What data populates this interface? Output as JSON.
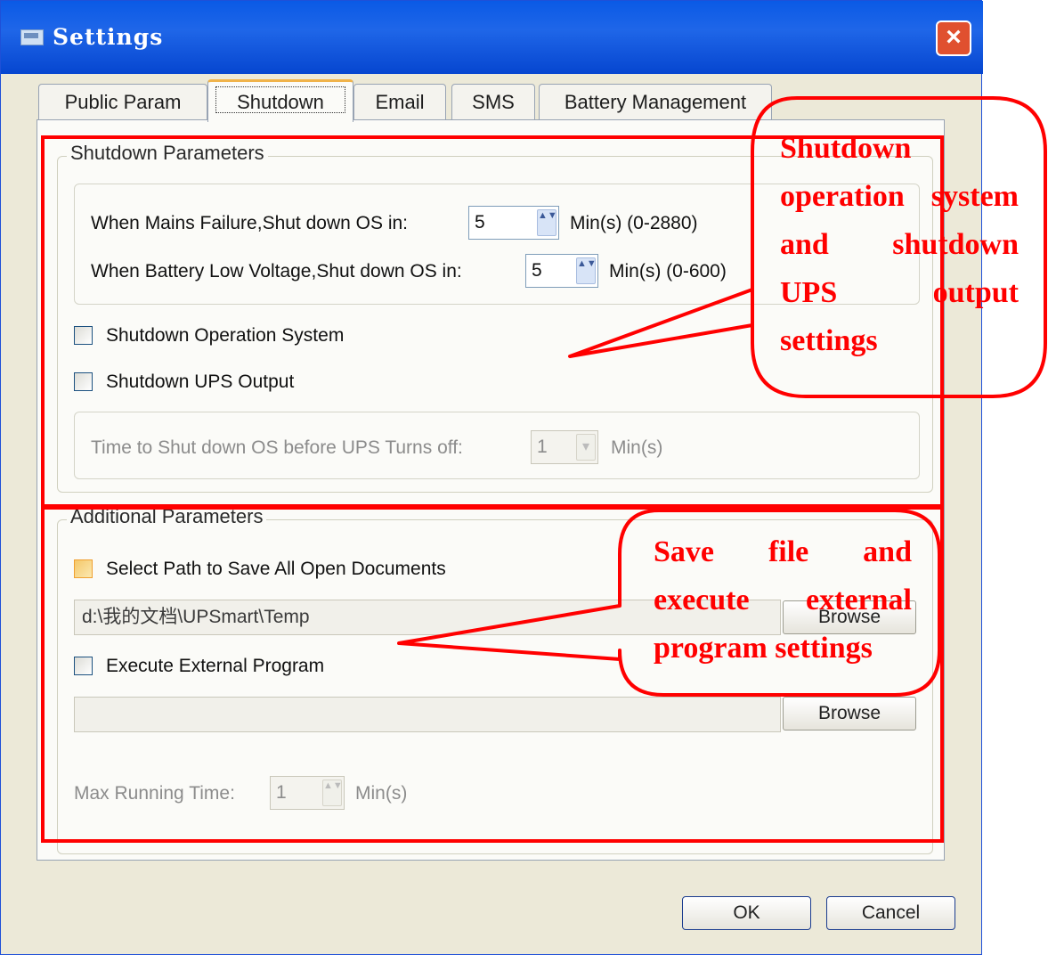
{
  "window": {
    "title": "Settings",
    "close_glyph": "×"
  },
  "tabs": [
    {
      "label": "Public Param",
      "active": false
    },
    {
      "label": "Shutdown",
      "active": true
    },
    {
      "label": "Email",
      "active": false
    },
    {
      "label": "SMS",
      "active": false
    },
    {
      "label": "Battery Management",
      "active": false
    }
  ],
  "shutdown_params": {
    "legend": "Shutdown Parameters",
    "mains_failure_label": "When Mains Failure,Shut down OS in:",
    "mains_failure_value": "5",
    "mains_failure_unit": "Min(s)  (0-2880)",
    "battery_low_label": "When Battery Low Voltage,Shut down OS in:",
    "battery_low_value": "5",
    "battery_low_unit": "Min(s)  (0-600)",
    "shutdown_os_label": "Shutdown Operation System",
    "shutdown_ups_label": "Shutdown UPS Output",
    "time_before_label": "Time to Shut down OS before UPS Turns off:",
    "time_before_value": "1",
    "time_before_unit": "Min(s)"
  },
  "additional_params": {
    "legend": "Additional Parameters",
    "select_path_label": "Select Path to Save All Open Documents",
    "path_value": "d:\\我的文档\\UPSmart\\Temp",
    "browse_label_1": "Browse",
    "execute_label": "Execute External Program",
    "program_value": "",
    "browse_label_2": "Browse",
    "max_running_label": "Max Running Time:",
    "max_running_value": "1",
    "max_running_unit": "Min(s)"
  },
  "footer": {
    "ok_label": "OK",
    "cancel_label": "Cancel"
  },
  "annotations": {
    "callout1": "Shutdown operation system and shutdown UPS output settings",
    "callout2": "Save file and execute external program settings",
    "color": "#ff0000"
  },
  "icons": {
    "spin_arrows": "▲▼",
    "dropdown_arrow": "▾"
  }
}
